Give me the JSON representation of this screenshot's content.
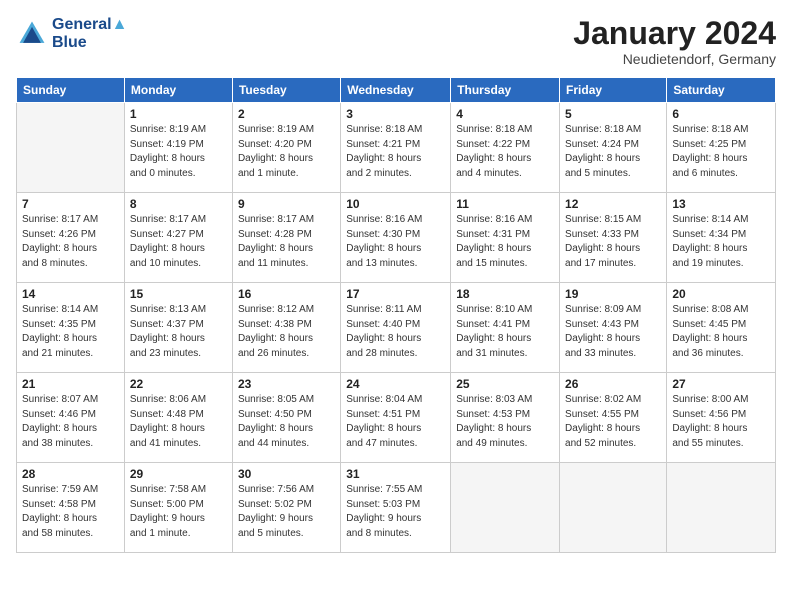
{
  "header": {
    "logo_line1": "General",
    "logo_line2": "Blue",
    "month_title": "January 2024",
    "location": "Neudietendorf, Germany"
  },
  "days_of_week": [
    "Sunday",
    "Monday",
    "Tuesday",
    "Wednesday",
    "Thursday",
    "Friday",
    "Saturday"
  ],
  "weeks": [
    [
      {
        "day": "",
        "info": ""
      },
      {
        "day": "1",
        "info": "Sunrise: 8:19 AM\nSunset: 4:19 PM\nDaylight: 8 hours\nand 0 minutes."
      },
      {
        "day": "2",
        "info": "Sunrise: 8:19 AM\nSunset: 4:20 PM\nDaylight: 8 hours\nand 1 minute."
      },
      {
        "day": "3",
        "info": "Sunrise: 8:18 AM\nSunset: 4:21 PM\nDaylight: 8 hours\nand 2 minutes."
      },
      {
        "day": "4",
        "info": "Sunrise: 8:18 AM\nSunset: 4:22 PM\nDaylight: 8 hours\nand 4 minutes."
      },
      {
        "day": "5",
        "info": "Sunrise: 8:18 AM\nSunset: 4:24 PM\nDaylight: 8 hours\nand 5 minutes."
      },
      {
        "day": "6",
        "info": "Sunrise: 8:18 AM\nSunset: 4:25 PM\nDaylight: 8 hours\nand 6 minutes."
      }
    ],
    [
      {
        "day": "7",
        "info": "Sunrise: 8:17 AM\nSunset: 4:26 PM\nDaylight: 8 hours\nand 8 minutes."
      },
      {
        "day": "8",
        "info": "Sunrise: 8:17 AM\nSunset: 4:27 PM\nDaylight: 8 hours\nand 10 minutes."
      },
      {
        "day": "9",
        "info": "Sunrise: 8:17 AM\nSunset: 4:28 PM\nDaylight: 8 hours\nand 11 minutes."
      },
      {
        "day": "10",
        "info": "Sunrise: 8:16 AM\nSunset: 4:30 PM\nDaylight: 8 hours\nand 13 minutes."
      },
      {
        "day": "11",
        "info": "Sunrise: 8:16 AM\nSunset: 4:31 PM\nDaylight: 8 hours\nand 15 minutes."
      },
      {
        "day": "12",
        "info": "Sunrise: 8:15 AM\nSunset: 4:33 PM\nDaylight: 8 hours\nand 17 minutes."
      },
      {
        "day": "13",
        "info": "Sunrise: 8:14 AM\nSunset: 4:34 PM\nDaylight: 8 hours\nand 19 minutes."
      }
    ],
    [
      {
        "day": "14",
        "info": "Sunrise: 8:14 AM\nSunset: 4:35 PM\nDaylight: 8 hours\nand 21 minutes."
      },
      {
        "day": "15",
        "info": "Sunrise: 8:13 AM\nSunset: 4:37 PM\nDaylight: 8 hours\nand 23 minutes."
      },
      {
        "day": "16",
        "info": "Sunrise: 8:12 AM\nSunset: 4:38 PM\nDaylight: 8 hours\nand 26 minutes."
      },
      {
        "day": "17",
        "info": "Sunrise: 8:11 AM\nSunset: 4:40 PM\nDaylight: 8 hours\nand 28 minutes."
      },
      {
        "day": "18",
        "info": "Sunrise: 8:10 AM\nSunset: 4:41 PM\nDaylight: 8 hours\nand 31 minutes."
      },
      {
        "day": "19",
        "info": "Sunrise: 8:09 AM\nSunset: 4:43 PM\nDaylight: 8 hours\nand 33 minutes."
      },
      {
        "day": "20",
        "info": "Sunrise: 8:08 AM\nSunset: 4:45 PM\nDaylight: 8 hours\nand 36 minutes."
      }
    ],
    [
      {
        "day": "21",
        "info": "Sunrise: 8:07 AM\nSunset: 4:46 PM\nDaylight: 8 hours\nand 38 minutes."
      },
      {
        "day": "22",
        "info": "Sunrise: 8:06 AM\nSunset: 4:48 PM\nDaylight: 8 hours\nand 41 minutes."
      },
      {
        "day": "23",
        "info": "Sunrise: 8:05 AM\nSunset: 4:50 PM\nDaylight: 8 hours\nand 44 minutes."
      },
      {
        "day": "24",
        "info": "Sunrise: 8:04 AM\nSunset: 4:51 PM\nDaylight: 8 hours\nand 47 minutes."
      },
      {
        "day": "25",
        "info": "Sunrise: 8:03 AM\nSunset: 4:53 PM\nDaylight: 8 hours\nand 49 minutes."
      },
      {
        "day": "26",
        "info": "Sunrise: 8:02 AM\nSunset: 4:55 PM\nDaylight: 8 hours\nand 52 minutes."
      },
      {
        "day": "27",
        "info": "Sunrise: 8:00 AM\nSunset: 4:56 PM\nDaylight: 8 hours\nand 55 minutes."
      }
    ],
    [
      {
        "day": "28",
        "info": "Sunrise: 7:59 AM\nSunset: 4:58 PM\nDaylight: 8 hours\nand 58 minutes."
      },
      {
        "day": "29",
        "info": "Sunrise: 7:58 AM\nSunset: 5:00 PM\nDaylight: 9 hours\nand 1 minute."
      },
      {
        "day": "30",
        "info": "Sunrise: 7:56 AM\nSunset: 5:02 PM\nDaylight: 9 hours\nand 5 minutes."
      },
      {
        "day": "31",
        "info": "Sunrise: 7:55 AM\nSunset: 5:03 PM\nDaylight: 9 hours\nand 8 minutes."
      },
      {
        "day": "",
        "info": ""
      },
      {
        "day": "",
        "info": ""
      },
      {
        "day": "",
        "info": ""
      }
    ]
  ]
}
